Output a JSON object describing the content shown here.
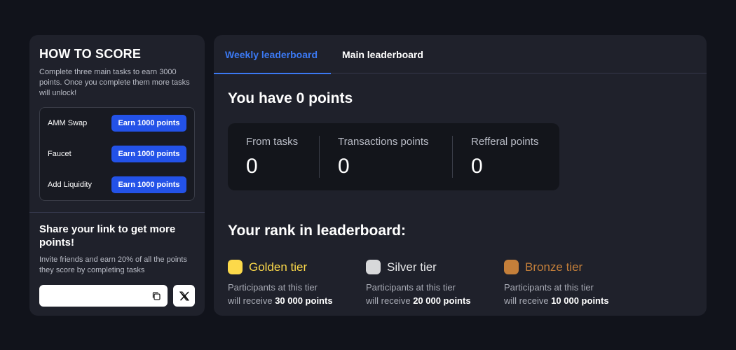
{
  "score": {
    "title": "HOW TO SCORE",
    "description": "Complete three main tasks to earn 3000 points. Once you complete them more tasks will unlock!",
    "tasks": [
      {
        "label": "AMM Swap",
        "button": "Earn 1000 points"
      },
      {
        "label": "Faucet",
        "button": "Earn 1000 points"
      },
      {
        "label": "Add Liquidity",
        "button": "Earn 1000 points"
      }
    ]
  },
  "share": {
    "title": "Share your link to get more points!",
    "description": "Invite friends and earn 20% of all the points they score by completing tasks",
    "link_value": "",
    "icons": {
      "copy": "copy-icon",
      "x": "x-logo-icon"
    }
  },
  "tabs": [
    {
      "label": "Weekly leaderboard",
      "active": true
    },
    {
      "label": "Main leaderboard",
      "active": false
    }
  ],
  "points": {
    "title": "You have 0 points",
    "stats": [
      {
        "label": "From tasks",
        "value": "0"
      },
      {
        "label": "Transactions points",
        "value": "0"
      },
      {
        "label": "Refferal points",
        "value": "0"
      }
    ]
  },
  "rank": {
    "title": "Your rank in leaderboard:",
    "tiers": [
      {
        "name": "Golden tier",
        "color": "#fcd94a",
        "desc_prefix": "Participants at this tier",
        "desc_mid": "will receive ",
        "reward": "30 000 points"
      },
      {
        "name": "Silver tier",
        "color": "#d7d8da",
        "desc_prefix": "Participants at this tier",
        "desc_mid": "will receive ",
        "reward": "20 000 points"
      },
      {
        "name": "Bronze tier",
        "color": "#c47f3a",
        "desc_prefix": "Participants at this tier",
        "desc_mid": "will receive ",
        "reward": "10 000 points"
      }
    ]
  },
  "colors": {
    "background": "#11131b",
    "panel": "#1f212b",
    "accent": "#2352e8",
    "tab_active": "#3b79f3"
  }
}
